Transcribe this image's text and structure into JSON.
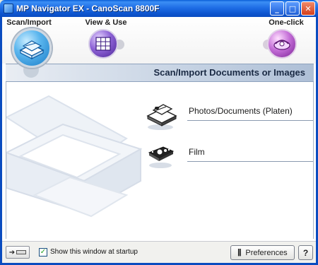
{
  "window": {
    "title": "MP Navigator EX - CanoScan 8800F",
    "minimize_glyph": "_",
    "maximize_glyph": "□",
    "close_glyph": "✕"
  },
  "modes": [
    {
      "label": "Scan/Import",
      "icon": "scanner-icon",
      "selected": true
    },
    {
      "label": "View & Use",
      "icon": "grid-view-icon",
      "selected": false
    },
    {
      "label": "One-click",
      "icon": "one-click-icon",
      "selected": false
    }
  ],
  "header": {
    "title": "Scan/Import Documents or Images"
  },
  "options": [
    {
      "label": "Photos/Documents (Platen)",
      "icon": "photos-documents-icon"
    },
    {
      "label": "Film",
      "icon": "film-icon"
    }
  ],
  "footer": {
    "startup_checkbox_label": "Show this window at startup",
    "startup_checked": true,
    "check_glyph": "✓",
    "preferences_label": "Preferences",
    "preferences_glyph": "⫼",
    "help_label": "?",
    "nav_arrow": "➔"
  },
  "colors": {
    "titlebar": "#0a4cc0",
    "accent_blue": "#1a7dc8",
    "view_purple": "#8e64d6",
    "oneclick_magenta": "#c56fd8"
  }
}
